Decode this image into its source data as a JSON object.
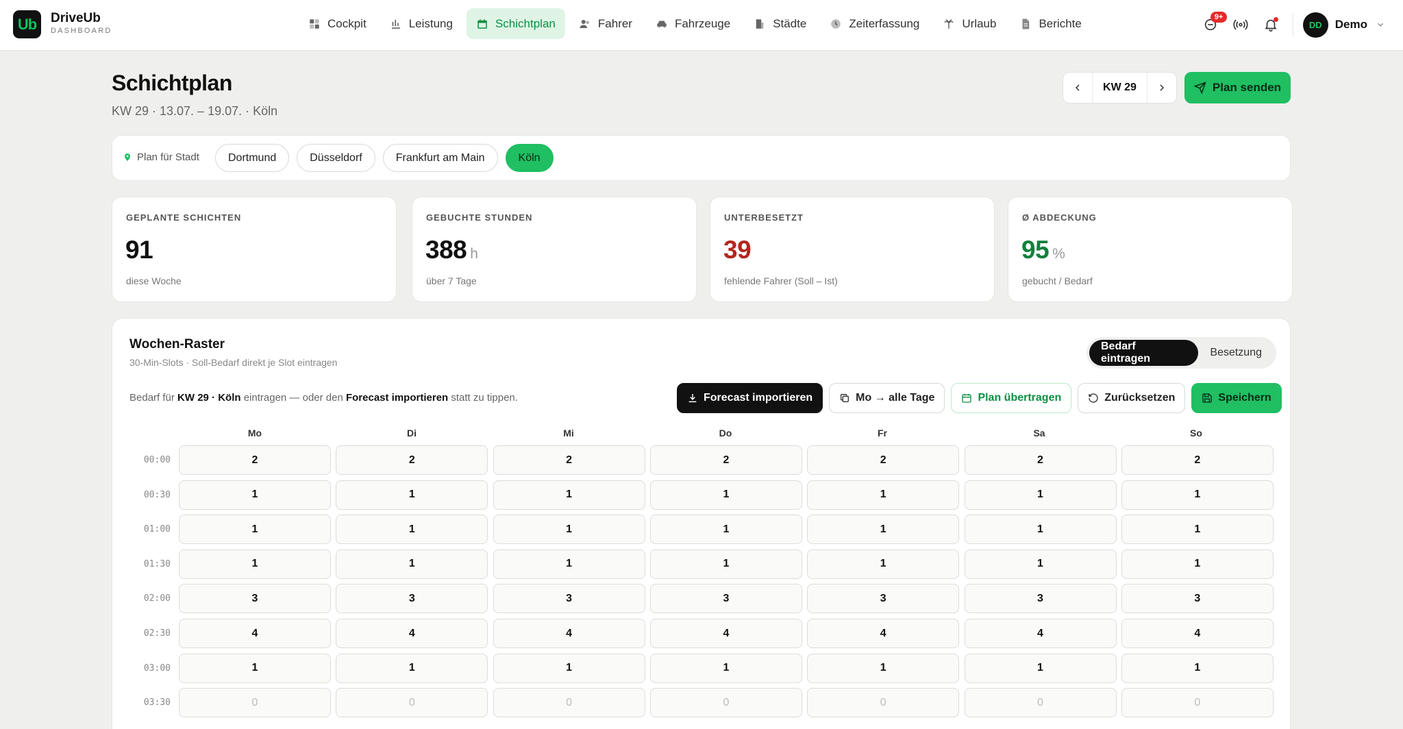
{
  "brand": {
    "logo": "Ub",
    "name": "DriveUb",
    "sub": "DASHBOARD"
  },
  "nav": [
    {
      "label": "Cockpit",
      "icon": "grid-icon"
    },
    {
      "label": "Leistung",
      "icon": "bar-chart-icon"
    },
    {
      "label": "Schichtplan",
      "icon": "calendar-icon",
      "active": true
    },
    {
      "label": "Fahrer",
      "icon": "users-icon"
    },
    {
      "label": "Fahrzeuge",
      "icon": "car-icon"
    },
    {
      "label": "Städte",
      "icon": "building-icon"
    },
    {
      "label": "Zeiterfassung",
      "icon": "clock-icon"
    },
    {
      "label": "Urlaub",
      "icon": "palm-tree-icon"
    },
    {
      "label": "Berichte",
      "icon": "file-icon"
    }
  ],
  "topbar": {
    "badge": "9+",
    "avatar_initials": "DD",
    "user_name": "Demo"
  },
  "header": {
    "title": "Schichtplan",
    "subtitle": "KW 29 · 13.07. – 19.07. · Köln",
    "week_label": "KW 29",
    "send_label": "Plan senden"
  },
  "cities": {
    "label": "Plan für Stadt",
    "items": [
      "Dortmund",
      "Düsseldorf",
      "Frankfurt am Main",
      "Köln"
    ],
    "active": "Köln"
  },
  "kpis": [
    {
      "label": "GEPLANTE SCHICHTEN",
      "value": "91",
      "unit": "",
      "foot": "diese Woche",
      "color": "#111111"
    },
    {
      "label": "GEBUCHTE STUNDEN",
      "value": "388",
      "unit": "h",
      "foot": "über 7 Tage",
      "color": "#111111"
    },
    {
      "label": "UNTERBESETZT",
      "value": "39",
      "unit": "",
      "foot": "fehlende Fahrer (Soll – Ist)",
      "color": "#b3261e"
    },
    {
      "label": "Ø ABDECKUNG",
      "value": "95",
      "unit": "%",
      "foot": "gebucht / Bedarf",
      "color": "#12803e"
    }
  ],
  "panel": {
    "title": "Wochen-Raster",
    "subtitle": "30-Min-Slots · Soll-Bedarf direkt je Slot eintragen",
    "seg": [
      "Bedarf eintragen",
      "Besetzung"
    ],
    "hint_pre": "Bedarf für ",
    "hint_bold1": "KW 29 · Köln",
    "hint_mid": " eintragen — oder den ",
    "hint_bold2": "Forecast importieren",
    "hint_post": " statt zu tippen.",
    "actions": {
      "forecast": "Forecast importieren",
      "copy": "Mo → alle Tage",
      "transfer": "Plan übertragen",
      "reset": "Zurücksetzen",
      "save": "Speichern"
    },
    "days": [
      "Mo",
      "Di",
      "Mi",
      "Do",
      "Fr",
      "Sa",
      "So"
    ],
    "slots": [
      {
        "time": "00:00",
        "values": [
          2,
          2,
          2,
          2,
          2,
          2,
          2
        ]
      },
      {
        "time": "00:30",
        "values": [
          1,
          1,
          1,
          1,
          1,
          1,
          1
        ]
      },
      {
        "time": "01:00",
        "values": [
          1,
          1,
          1,
          1,
          1,
          1,
          1
        ]
      },
      {
        "time": "01:30",
        "values": [
          1,
          1,
          1,
          1,
          1,
          1,
          1
        ]
      },
      {
        "time": "02:00",
        "values": [
          3,
          3,
          3,
          3,
          3,
          3,
          3
        ]
      },
      {
        "time": "02:30",
        "values": [
          4,
          4,
          4,
          4,
          4,
          4,
          4
        ]
      },
      {
        "time": "03:00",
        "values": [
          1,
          1,
          1,
          1,
          1,
          1,
          1
        ]
      },
      {
        "time": "03:30",
        "values": [
          0,
          0,
          0,
          0,
          0,
          0,
          0
        ]
      }
    ]
  }
}
